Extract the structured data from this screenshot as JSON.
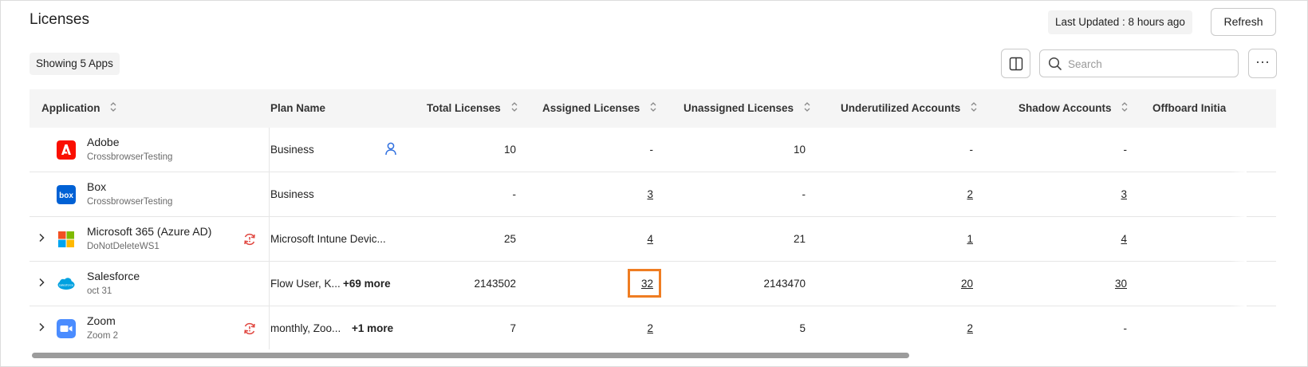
{
  "header": {
    "title": "Licenses",
    "last_updated": "Last Updated : 8 hours ago",
    "refresh_label": "Refresh"
  },
  "toolbar": {
    "showing": "Showing 5 Apps",
    "search_placeholder": "Search",
    "more_label": "···"
  },
  "columns": {
    "application": "Application",
    "plan_name": "Plan Name",
    "total": "Total Licenses",
    "assigned": "Assigned Licenses",
    "unassigned": "Unassigned Licenses",
    "underutilized": "Underutilized Accounts",
    "shadow": "Shadow Accounts",
    "offboard": "Offboard Initia"
  },
  "rows": [
    {
      "name": "Adobe",
      "sub": "CrossbrowserTesting",
      "logo": "adobe-logo-icon",
      "plan": "Business",
      "more": "",
      "total": "10",
      "assigned": "-",
      "unassigned": "10",
      "underutilized": "-",
      "shadow": "-"
    },
    {
      "name": "Box",
      "sub": "CrossbrowserTesting",
      "logo": "box-logo-icon",
      "plan": "Business",
      "more": "",
      "total": "-",
      "assigned": "3",
      "unassigned": "-",
      "underutilized": "2",
      "shadow": "3"
    },
    {
      "name": "Microsoft 365 (Azure AD)",
      "sub": "DoNotDeleteWS1",
      "logo": "microsoft-logo-icon",
      "plan": "Microsoft Intune Devic...",
      "more": "",
      "total": "25",
      "assigned": "4",
      "unassigned": "21",
      "underutilized": "1",
      "shadow": "4"
    },
    {
      "name": "Salesforce",
      "sub": "oct 31",
      "logo": "salesforce-logo-icon",
      "plan": "Flow User, K...",
      "more": "+69 more",
      "total": "2143502",
      "assigned": "32",
      "unassigned": "2143470",
      "underutilized": "20",
      "shadow": "30"
    },
    {
      "name": "Zoom",
      "sub": "Zoom 2",
      "logo": "zoom-logo-icon",
      "plan": "monthly, Zoo...",
      "more": "+1 more",
      "total": "7",
      "assigned": "2",
      "unassigned": "5",
      "underutilized": "2",
      "shadow": "-"
    }
  ],
  "colors": {
    "highlight": "#ef7d22",
    "adobe": "#fa0f00",
    "box": "#0061d5",
    "salesforce": "#00a1e0",
    "zoom": "#4a8cff",
    "sync_icon": "#e0463f",
    "user_icon": "#2f6fdf"
  }
}
